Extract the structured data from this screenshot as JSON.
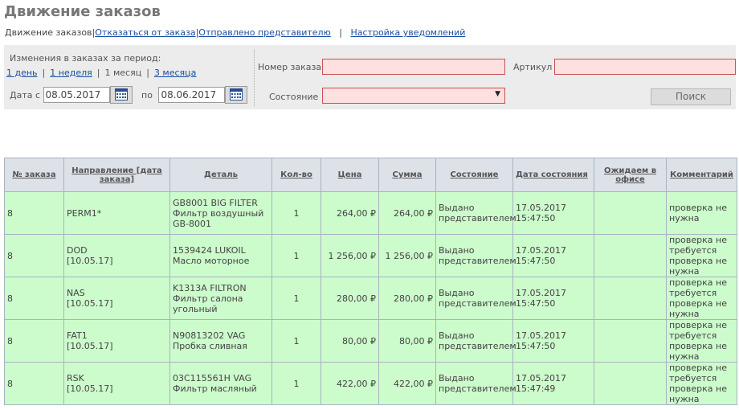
{
  "page": {
    "title": "Движение заказов"
  },
  "tabs": {
    "active": "Движение заказов",
    "cancel": "Отказаться от заказа",
    "sent": "Отправлено представителю",
    "notify": "Настройка уведомлений"
  },
  "filter": {
    "period_caption": "Изменения в заказах за период:",
    "periods": [
      "1 день",
      "1 неделя",
      "1 месяц",
      "3 месяца"
    ],
    "active_period": "1 месяц",
    "date_from_label": "Дата с",
    "date_from": "08.05.2017",
    "date_to_label": "по",
    "date_to": "08.06.2017",
    "order_no_label": "Номер заказа",
    "order_no_value": "",
    "article_label": "Артикул",
    "article_value": "",
    "status_label": "Состояние",
    "status_value": "",
    "search_button": "Поиск"
  },
  "table": {
    "headers": [
      "№ заказа",
      "Направление [дата заказа]",
      "Деталь",
      "Кол-во",
      "Цена",
      "Сумма",
      "Состояние",
      "Дата состояния",
      "Ожидаем в офисе",
      "Комментарий"
    ],
    "rows": [
      {
        "order": "8",
        "direction": [
          "PERM1*"
        ],
        "detail": [
          "GB8001 BIG FILTER",
          "Фильтр воздушный",
          "GB-8001"
        ],
        "qty": "1",
        "price": "264,00 ₽",
        "sum": "264,00 ₽",
        "status": [
          "Выдано",
          "представителем"
        ],
        "status_date": [
          "17.05.2017",
          "15:47:50"
        ],
        "expected": "",
        "comment": [
          "проверка не",
          "нужна"
        ]
      },
      {
        "order": "8",
        "direction": [
          "DOD",
          "[10.05.17]"
        ],
        "detail": [
          "1539424 LUKOIL",
          "Масло моторное"
        ],
        "qty": "1",
        "price": "1 256,00 ₽",
        "sum": "1 256,00 ₽",
        "status": [
          "Выдано",
          "представителем"
        ],
        "status_date": [
          "17.05.2017",
          "15:47:50"
        ],
        "expected": "",
        "comment": [
          "проверка не",
          "требуется",
          "проверка не",
          "нужна"
        ]
      },
      {
        "order": "8",
        "direction": [
          "NAS",
          "[10.05.17]"
        ],
        "detail": [
          "K1313A FILTRON",
          "Фильтр салона",
          "угольный"
        ],
        "qty": "1",
        "price": "280,00 ₽",
        "sum": "280,00 ₽",
        "status": [
          "Выдано",
          "представителем"
        ],
        "status_date": [
          "17.05.2017",
          "15:47:50"
        ],
        "expected": "",
        "comment": [
          "проверка не",
          "требуется",
          "проверка не",
          "нужна"
        ]
      },
      {
        "order": "8",
        "direction": [
          "FAT1",
          "[10.05.17]"
        ],
        "detail": [
          "N90813202 VAG",
          "Пробка сливная"
        ],
        "qty": "1",
        "price": "80,00 ₽",
        "sum": "80,00 ₽",
        "status": [
          "Выдано",
          "представителем"
        ],
        "status_date": [
          "17.05.2017",
          "15:47:50"
        ],
        "expected": "",
        "comment": [
          "проверка не",
          "требуется",
          "проверка не",
          "нужна"
        ]
      },
      {
        "order": "8",
        "direction": [
          "RSK",
          "[10.05.17]"
        ],
        "detail": [
          "03C115561H VAG",
          "Фильтр масляный"
        ],
        "qty": "1",
        "price": "422,00 ₽",
        "sum": "422,00 ₽",
        "status": [
          "Выдано",
          "представителем"
        ],
        "status_date": [
          "17.05.2017",
          "15:47:49"
        ],
        "expected": "",
        "comment": [
          "проверка не",
          "требуется",
          "проверка не",
          "нужна"
        ]
      }
    ]
  }
}
